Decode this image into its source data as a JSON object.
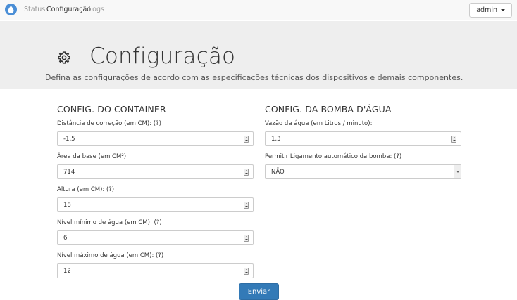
{
  "navbar": {
    "logo_icon": "water-drop-icon",
    "links": [
      "Status",
      "Configuração",
      "Logs"
    ],
    "active_link": "Configuração",
    "user_menu": "admin"
  },
  "header": {
    "title": "Configuração",
    "icon": "gear-icon",
    "subtitle": "Defina as configurações de acordo com as especificações técnicas dos dispositivos e demais componentes."
  },
  "container": {
    "title": "CONFIG. DO CONTAINER",
    "fields": [
      {
        "label": "Distância de correção (em CM): (?)",
        "value": "-1,5"
      },
      {
        "label": "Área da base (em CM²):",
        "value": "714"
      },
      {
        "label": "Altura (em CM): (?)",
        "value": "18"
      },
      {
        "label": "Nível mínimo de água (em CM): (?)",
        "value": "6"
      },
      {
        "label": "Nível máximo de água (em CM): (?)",
        "value": "12"
      }
    ]
  },
  "pump": {
    "title": "CONFIG. DA BOMBA D'ÁGUA",
    "flow_label": "Vazão da água (em Litros / minuto):",
    "flow_value": "1,3",
    "auto_label": "Permitir Ligamento automático da bomba: (?)",
    "auto_value": "NÃO"
  },
  "actions": {
    "submit_label": "Enviar"
  },
  "colors": {
    "primary": "#337ab7",
    "jumbotron": "#eeeeee",
    "navbar": "#f8f8f8"
  }
}
